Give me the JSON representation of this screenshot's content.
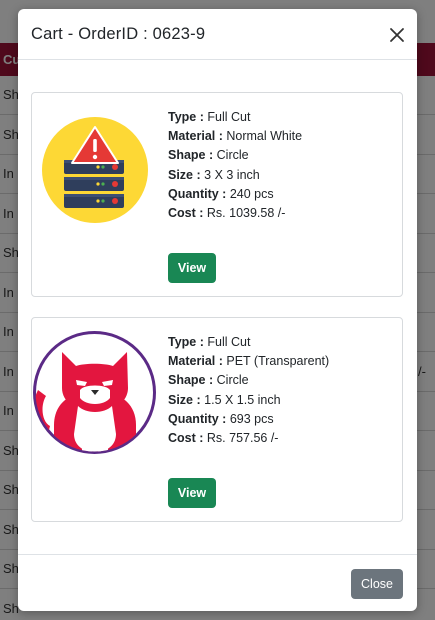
{
  "background": {
    "header_text": "Cu",
    "rows": [
      {
        "text": "Sh",
        "right": ""
      },
      {
        "text": "Sh",
        "right": ""
      },
      {
        "text": "In",
        "right": ""
      },
      {
        "text": "In",
        "right": ""
      },
      {
        "text": "Sh",
        "right": ""
      },
      {
        "text": "In",
        "right": ""
      },
      {
        "text": "In",
        "right": ""
      },
      {
        "text": "In",
        "right": "/-"
      },
      {
        "text": "In",
        "right": ""
      },
      {
        "text": "Sh",
        "right": ""
      },
      {
        "text": "Sh",
        "right": ""
      },
      {
        "text": "Sh",
        "right": ""
      },
      {
        "text": "Sh",
        "right": ""
      },
      {
        "text": "Sh",
        "right": ""
      }
    ]
  },
  "modal": {
    "title": "Cart - OrderID : 0623-9",
    "close_label": "Close"
  },
  "items": [
    {
      "type_label": "Type :",
      "type_value": "Full Cut",
      "material_label": "Material :",
      "material_value": "Normal White",
      "shape_label": "Shape :",
      "shape_value": "Circle",
      "size_label": "Size :",
      "size_value": "3 X 3 inch",
      "quantity_label": "Quantity :",
      "quantity_value": "240 pcs",
      "cost_label": "Cost :",
      "cost_value": "Rs. 1039.58 /-",
      "view_label": "View",
      "image_icon": "server-warning-icon"
    },
    {
      "type_label": "Type :",
      "type_value": "Full Cut",
      "material_label": "Material :",
      "material_value": "PET (Transparent)",
      "shape_label": "Shape :",
      "shape_value": "Circle",
      "size_label": "Size :",
      "size_value": "1.5 X 1.5 inch",
      "quantity_label": "Quantity :",
      "quantity_value": "693 pcs",
      "cost_label": "Cost :",
      "cost_value": "Rs. 757.56 /-",
      "view_label": "View",
      "image_icon": "cat-logo-icon"
    }
  ],
  "colors": {
    "header_bg": "#9e1239",
    "view_button": "#198754",
    "close_button": "#6c757d",
    "cat_red": "#e3163f",
    "cat_ring": "#5b2a86",
    "server_bg": "#fdd835"
  }
}
